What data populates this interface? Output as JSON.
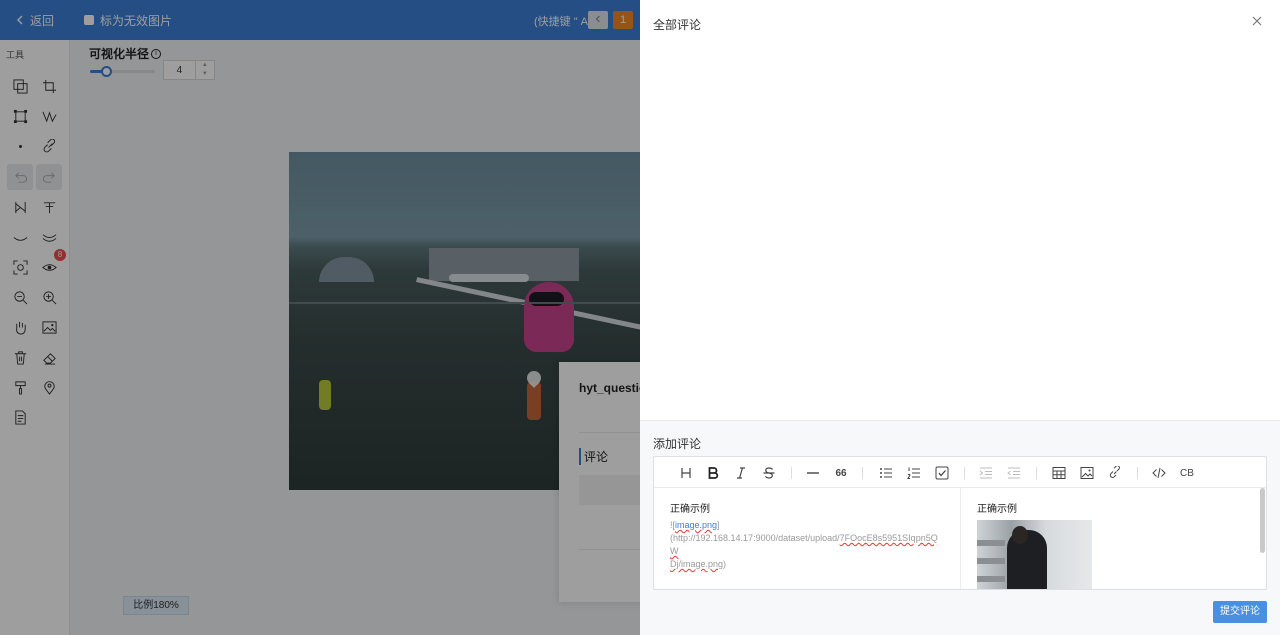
{
  "topbar": {
    "back_label": "返回",
    "invalid_label": "标为无效图片",
    "shortcut_hint": "(快捷键 \" A \")",
    "page_current": "1",
    "prev_icon": "chevron-left-icon"
  },
  "toolbox": {
    "title": "工具",
    "eye_badge": "8",
    "tools": [
      "copy-icon",
      "crop-icon",
      "rectangle-icon",
      "polyline-icon",
      "point-icon",
      "link-icon",
      "undo-icon",
      "redo-icon",
      "split-icon",
      "text-format-icon",
      "curve-icon",
      "curve-fill-icon",
      "focus-icon",
      "eye-icon",
      "zoom-out-icon",
      "zoom-in-icon",
      "hand-icon",
      "image-icon",
      "trash-icon",
      "eraser-icon",
      "brush-icon",
      "location-icon",
      "notes-icon"
    ]
  },
  "radius": {
    "label": "可视化半径",
    "value": "4",
    "slider_fraction": 0.25
  },
  "question_card": {
    "title": "hyt_questio",
    "comment_tab": "评论"
  },
  "zoom": {
    "label": "比例180%"
  },
  "drawer": {
    "title": "全部评论",
    "add_title": "添加评论",
    "submit_label": "提交评论",
    "toolbar_icons": [
      "heading-icon",
      "bold-icon",
      "italic-icon",
      "strikethrough-icon",
      "horizontal-rule-icon",
      "quote-icon",
      "bullet-list-icon",
      "ordered-list-icon",
      "task-list-icon",
      "indent-icon",
      "outdent-icon",
      "table-icon",
      "image-icon",
      "link-icon",
      "code-icon",
      "code-block-icon"
    ],
    "codeblock_label": "CB",
    "quote_label": "66",
    "editor": {
      "heading": "正确示例",
      "image_alt_open": "![",
      "image_alt": "image.png",
      "image_alt_close": "]",
      "url_prefix": "(http://192.168.14.17:9000/dataset/upload/",
      "url_middle": "7FOocE8s5951SIqpn5QW",
      "url_tail_word": "Dj/image.png",
      "url_close": ")"
    },
    "preview": {
      "heading": "正确示例"
    }
  },
  "colors": {
    "brand_blue": "#3a7fd6",
    "page_orange": "#f08a24",
    "badge_red": "#f04b4b",
    "submit_blue": "#4a90e2"
  }
}
